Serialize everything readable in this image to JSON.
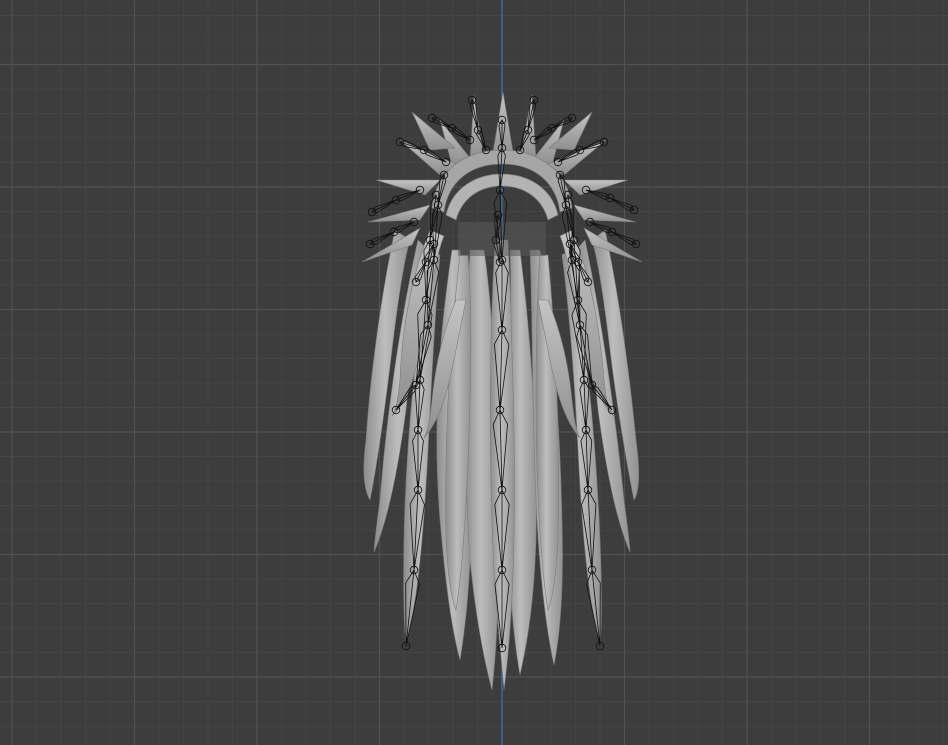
{
  "viewport": {
    "view": "front-orthographic",
    "background_color": "#3d3d3d",
    "grid_minor_color": "#474747",
    "grid_major_color": "#525252",
    "z_axis_color": "#3f6fb0",
    "mesh_color": "#a9a9a9",
    "mesh_shade_color": "#8a8a8a",
    "bone_color": "#111111"
  },
  "scene_objects": {
    "mesh": "hair-mesh",
    "armature": "hair-armature",
    "strand_count": 12,
    "bone_chain_count": 5
  }
}
